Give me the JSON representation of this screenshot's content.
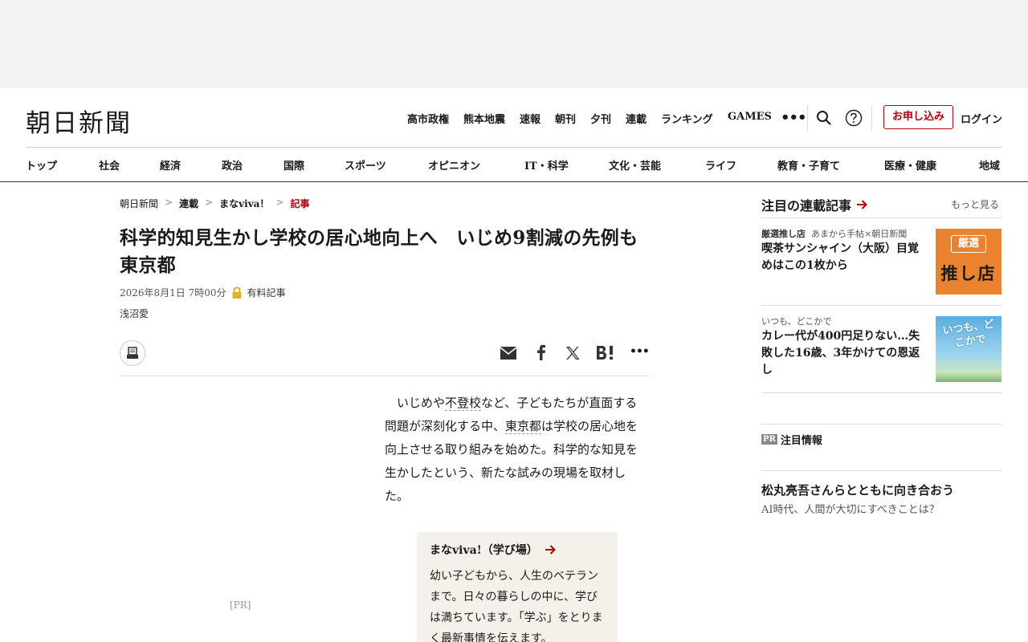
{
  "header": {
    "logo": "朝日新聞",
    "nav": [
      "高市政権",
      "熊本地震",
      "速報",
      "朝刊",
      "夕刊",
      "連載",
      "ランキング",
      "GAMES"
    ],
    "subscribe": "お申し込み",
    "login": "ログイン"
  },
  "categories": [
    "トップ",
    "社会",
    "経済",
    "政治",
    "国際",
    "スポーツ",
    "オピニオン",
    "IT・科学",
    "文化・芸能",
    "ライフ",
    "教育・子育て",
    "医療・健康",
    "地域"
  ],
  "breadcrumb": [
    "朝日新聞",
    "連載",
    "まなviva！",
    "記事"
  ],
  "article": {
    "title": "科学的知見生かし学校の居心地向上へ　いじめ9割減の先例も　東京都",
    "date": "2026年8月1日 7時00分",
    "paid_label": "有料記事",
    "author": "浅沼愛",
    "lead_parts": [
      "いじめや",
      "不登校",
      "など、子どもたちが直面する問題が深刻化する中、",
      "東京都",
      "は学校の居心地を向上させる取り組みを始めた。科学的な知見を生かしたという、新たな試みの現場を取材した。"
    ]
  },
  "pr_left": "[PR]",
  "series_box": {
    "title": "まなviva!（学び場）",
    "desc": "幼い子どもから、人生のベテランまで。日々の暮らしの中に、学びは満ちています。「学ぶ」をとりまく最新事情を伝えます。"
  },
  "sidebar": {
    "title": "注目の連載記事",
    "more": "もっと見る",
    "items": [
      {
        "tag_bold": "厳選推し店",
        "tag": "あまから手帖×朝日新聞",
        "title": "喫茶サンシャイン（大阪）目覚めはこの1枚から",
        "thumb_badge": "厳選",
        "thumb_text": "推し店"
      },
      {
        "tag_bold": "",
        "tag": "いつも、どこかで",
        "title": "カレー代が400円足りない…失敗した16歳、3年かけての恩返し",
        "thumb_text": "いつも、どこかで"
      }
    ],
    "pr_badge": "PR",
    "pr_label": "注目情報",
    "promo_title": "松丸亮吾さんらとともに向き合おう",
    "promo_sub": "AI時代、人間が大切にすべきことは？"
  },
  "colors": {
    "accent": "#b5000f",
    "thumb1": "#e98330"
  }
}
